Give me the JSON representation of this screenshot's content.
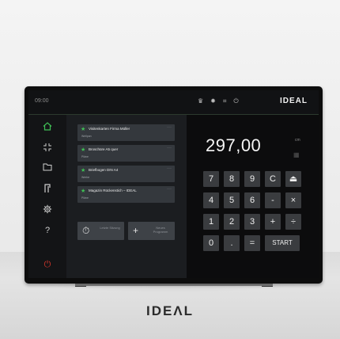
{
  "topbar": {
    "time": "09:00",
    "status_icons": [
      "♛",
      "✹",
      "⌗",
      "⏻"
    ],
    "logo": "IDEAL"
  },
  "sidebar": {
    "items": [
      {
        "name": "home-icon"
      },
      {
        "name": "fullscreen-icon"
      },
      {
        "name": "folder-icon"
      },
      {
        "name": "cutter-icon"
      },
      {
        "name": "gear-icon"
      },
      {
        "name": "help-icon",
        "glyph": "?"
      },
      {
        "name": "power-icon",
        "glyph": "⏻"
      }
    ]
  },
  "jobs": [
    {
      "title": "Visitenkarten Firma Müller",
      "sub": "Wellpan"
    },
    {
      "title": "Broschüre A5 quer",
      "sub": "Pläne"
    },
    {
      "title": "Briefbogen DIN A4",
      "sub": "Werbe"
    },
    {
      "title": "Magazin Rückenstich – IDEAL",
      "sub": "Pläne"
    }
  ],
  "job_menu_glyph": "···",
  "job_buttons": {
    "last": {
      "icon": "⏱",
      "label": "Letzte Sitzung"
    },
    "new": {
      "icon": "+",
      "label": "Neues Programm"
    }
  },
  "calc": {
    "display": "297,00",
    "unit": "cm",
    "keys_row1": [
      "7",
      "8",
      "9",
      "C",
      "⏏"
    ],
    "keys_row2": [
      "4",
      "5",
      "6",
      "-",
      "×"
    ],
    "keys_row3": [
      "1",
      "2",
      "3",
      "+",
      "÷"
    ],
    "keys_row4": [
      "0",
      ".",
      "=",
      "START"
    ]
  },
  "device_brand": "IDEΛL",
  "colors": {
    "accent": "#3fbf55",
    "power": "#d4362a",
    "screen_bg": "#1d1f21"
  }
}
